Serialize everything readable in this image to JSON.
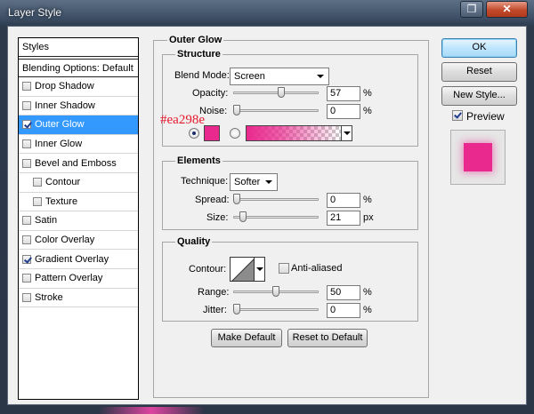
{
  "window": {
    "title": "Layer Style"
  },
  "styles_panel": {
    "header": "Styles",
    "blending": "Blending Options: Default",
    "items": [
      {
        "label": "Drop Shadow",
        "checked": false,
        "indent": false,
        "selected": false
      },
      {
        "label": "Inner Shadow",
        "checked": false,
        "indent": false,
        "selected": false
      },
      {
        "label": "Outer Glow",
        "checked": true,
        "indent": false,
        "selected": true
      },
      {
        "label": "Inner Glow",
        "checked": false,
        "indent": false,
        "selected": false
      },
      {
        "label": "Bevel and Emboss",
        "checked": false,
        "indent": false,
        "selected": false
      },
      {
        "label": "Contour",
        "checked": false,
        "indent": true,
        "selected": false
      },
      {
        "label": "Texture",
        "checked": false,
        "indent": true,
        "selected": false
      },
      {
        "label": "Satin",
        "checked": false,
        "indent": false,
        "selected": false
      },
      {
        "label": "Color Overlay",
        "checked": false,
        "indent": false,
        "selected": false
      },
      {
        "label": "Gradient Overlay",
        "checked": true,
        "indent": false,
        "selected": false
      },
      {
        "label": "Pattern Overlay",
        "checked": false,
        "indent": false,
        "selected": false
      },
      {
        "label": "Stroke",
        "checked": false,
        "indent": false,
        "selected": false
      }
    ]
  },
  "outer_glow": {
    "title": "Outer Glow",
    "structure": {
      "title": "Structure",
      "blend_mode_label": "Blend Mode:",
      "blend_mode_value": "Screen",
      "opacity_label": "Opacity:",
      "opacity_value": "57",
      "opacity_fraction": 0.57,
      "noise_label": "Noise:",
      "noise_value": "0",
      "noise_fraction": 0,
      "percent": "%",
      "color_hex": "#ea298e",
      "color_annotation": "#ea298e",
      "solid_selected": true
    },
    "elements": {
      "title": "Elements",
      "technique_label": "Technique:",
      "technique_value": "Softer",
      "spread_label": "Spread:",
      "spread_value": "0",
      "spread_fraction": 0,
      "size_label": "Size:",
      "size_value": "21",
      "size_fraction": 0.084,
      "percent": "%",
      "px": "px"
    },
    "quality": {
      "title": "Quality",
      "contour_label": "Contour:",
      "anti_aliased_label": "Anti-aliased",
      "anti_aliased": false,
      "range_label": "Range:",
      "range_value": "50",
      "range_fraction": 0.5,
      "jitter_label": "Jitter:",
      "jitter_value": "0",
      "jitter_fraction": 0,
      "percent": "%"
    },
    "make_default": "Make Default",
    "reset_default": "Reset to Default"
  },
  "buttons": {
    "ok": "OK",
    "reset": "Reset",
    "new_style": "New Style...",
    "preview_label": "Preview",
    "preview_checked": true
  },
  "icons": {
    "help": "help-icon",
    "close": "close-icon"
  }
}
